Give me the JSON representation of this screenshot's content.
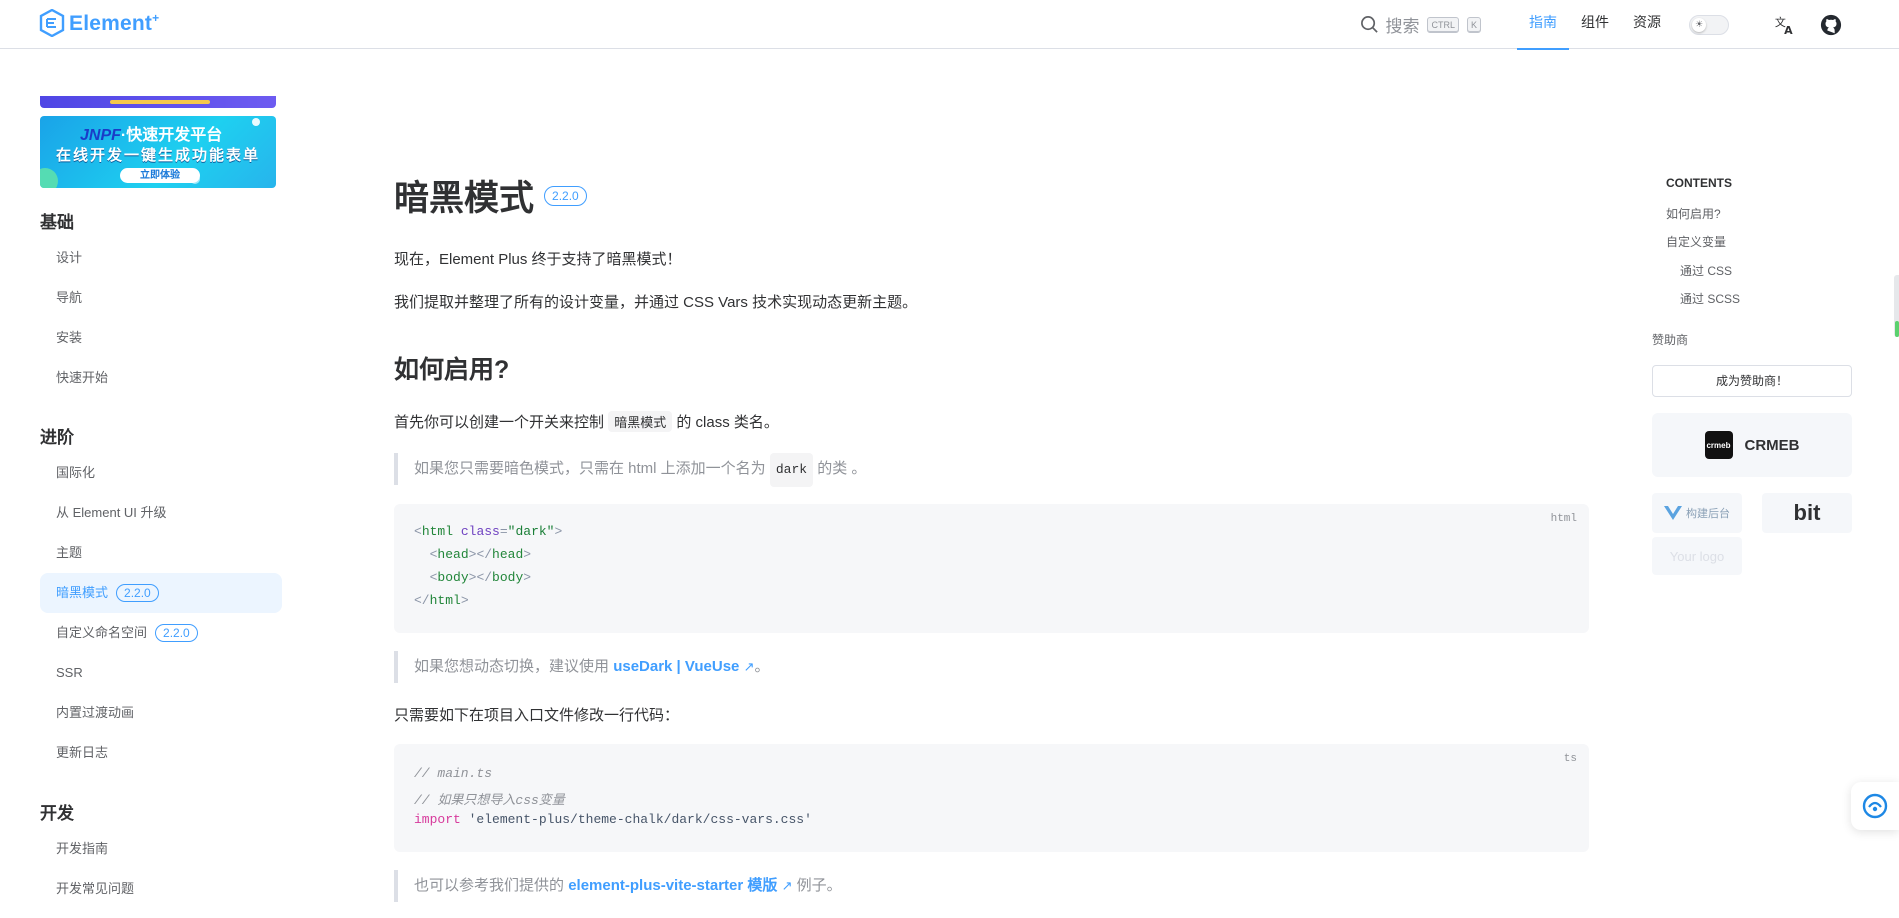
{
  "header": {
    "logo_text": "Element",
    "logo_sup": "+",
    "search_label": "搜索",
    "kbd_ctrl": "CTRL",
    "kbd_k": "K",
    "nav": [
      "指南",
      "组件",
      "资源"
    ],
    "active_nav": "指南",
    "theme_icon": "sun-icon",
    "lang_icon": "translate-icon",
    "github_icon": "github-icon"
  },
  "sidebar": {
    "ad": {
      "brand": "JNPF",
      "line1_rest": "·快速开发平台",
      "line2": "在线开发一键生成功能表单",
      "cta": "立即体验"
    },
    "sections": [
      {
        "title": "基础",
        "items": [
          {
            "label": "设计"
          },
          {
            "label": "导航"
          },
          {
            "label": "安装"
          },
          {
            "label": "快速开始"
          }
        ]
      },
      {
        "title": "进阶",
        "items": [
          {
            "label": "国际化"
          },
          {
            "label": "从 Element UI 升级"
          },
          {
            "label": "主题"
          },
          {
            "label": "暗黑模式",
            "badge": "2.2.0",
            "active": true
          },
          {
            "label": "自定义命名空间",
            "badge": "2.2.0"
          },
          {
            "label": "SSR"
          },
          {
            "label": "内置过渡动画"
          },
          {
            "label": "更新日志"
          }
        ]
      },
      {
        "title": "开发",
        "items": [
          {
            "label": "开发指南"
          },
          {
            "label": "开发常见问题"
          }
        ]
      }
    ]
  },
  "main": {
    "title": "暗黑模式",
    "title_badge": "2.2.0",
    "intro1": "现在，Element Plus 终于支持了暗黑模式！",
    "intro2": "我们提取并整理了所有的设计变量，并通过 CSS Vars 技术实现动态更新主题。",
    "h2": "如何启用?",
    "p_enable_pre": "首先你可以创建一个开关来控制",
    "p_enable_code": "暗黑模式",
    "p_enable_post": "的 class 类名。",
    "tip1_pre": "如果您只需要暗色模式，只需在 html 上添加一个名为",
    "tip1_code": "dark",
    "tip1_post": "的类 。",
    "code1": {
      "lang": "html",
      "lines": [
        "<html class=\"dark\">",
        "  <head></head>",
        "  <body></body>",
        "</html>"
      ]
    },
    "tip2_pre": "如果您想动态切换，建议使用",
    "tip2_link": "useDark | VueUse",
    "tip2_post": "。",
    "p_oneline": "只需要如下在项目入口文件修改一行代码：",
    "code2": {
      "lang": "ts",
      "comment1": "// main.ts",
      "comment2": "// 如果只想导入css变量",
      "kw": "import",
      "str": "'element-plus/theme-chalk/dark/css-vars.css'"
    },
    "tip3_pre": "也可以参考我们提供的",
    "tip3_link": "element-plus-vite-starter 模版",
    "tip3_post": "例子。"
  },
  "toc": {
    "title": "CONTENTS",
    "items": [
      "如何启用?",
      "自定义变量",
      "通过 CSS",
      "通过 SCSS"
    ],
    "sponsor_heading": "赞助商",
    "sponsor_button": "成为赞助商！",
    "sponsors": [
      "CRMEB",
      "构建后台",
      "bit",
      "Your logo"
    ]
  },
  "colors": {
    "accent": "#409eff",
    "text": "#303133",
    "muted": "#909399"
  }
}
